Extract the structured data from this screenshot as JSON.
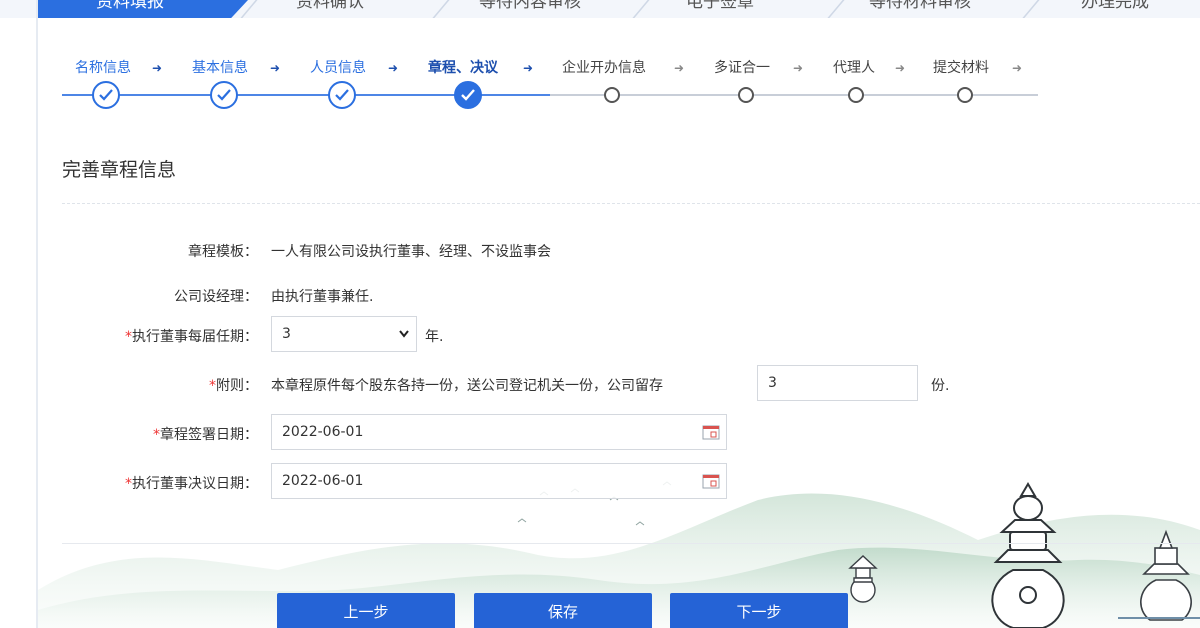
{
  "top_tabs": [
    {
      "label": "资料填报",
      "active": true
    },
    {
      "label": "资料确认",
      "active": false
    },
    {
      "label": "等待内容审核",
      "active": false
    },
    {
      "label": "电子签章",
      "active": false
    },
    {
      "label": "等待材料审核",
      "active": false
    },
    {
      "label": "办理完成",
      "active": false
    }
  ],
  "steps": [
    {
      "label": "名称信息",
      "status": "done"
    },
    {
      "label": "基本信息",
      "status": "done"
    },
    {
      "label": "人员信息",
      "status": "done"
    },
    {
      "label": "章程、决议",
      "status": "current"
    },
    {
      "label": "企业开办信息",
      "status": "todo"
    },
    {
      "label": "多证合一",
      "status": "todo"
    },
    {
      "label": "代理人",
      "status": "todo"
    },
    {
      "label": "提交材料",
      "status": "todo"
    }
  ],
  "step_arrow": "➜",
  "section_title": "完善章程信息",
  "form": {
    "template": {
      "label": "章程模板：",
      "value": "一人有限公司设执行董事、经理、不设监事会"
    },
    "manager": {
      "label": "公司设经理：",
      "value": "由执行董事兼任."
    },
    "term": {
      "required_mark": "*",
      "label": "执行董事每届任期：",
      "value": "3",
      "unit": "年."
    },
    "appendix": {
      "required_mark": "*",
      "label": "附则：",
      "text": "本章程原件每个股东各持一份，送公司登记机关一份，公司留存",
      "value": "3",
      "unit": "份."
    },
    "sign_date": {
      "required_mark": "*",
      "label": "章程签署日期：",
      "value": "2022-06-01"
    },
    "resolution_date": {
      "required_mark": "*",
      "label": "执行董事决议日期：",
      "value": "2022-06-01"
    }
  },
  "buttons": {
    "prev": "上一步",
    "save": "保存",
    "next": "下一步"
  },
  "colors": {
    "primary": "#2b6fe0",
    "button": "#2563d6",
    "required": "#e33333"
  }
}
